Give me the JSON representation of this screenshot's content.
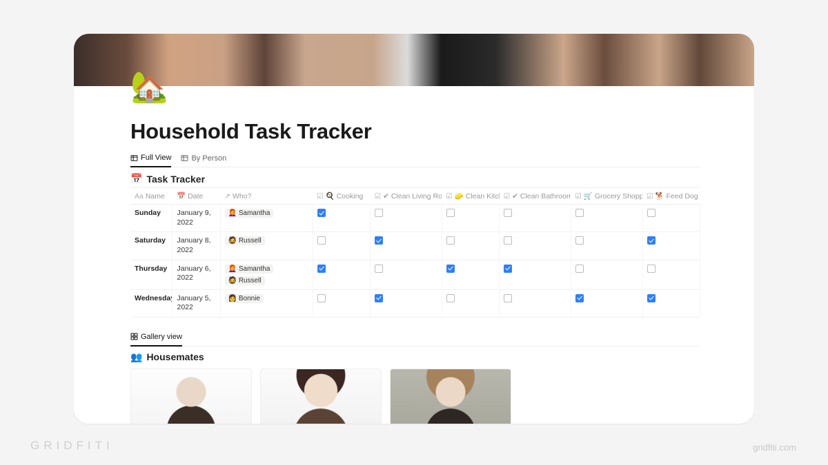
{
  "brand": {
    "left": "GRIDFITI",
    "right": "gridfiti.com"
  },
  "page": {
    "icon": "🏡",
    "title": "Household Task Tracker"
  },
  "tabs": [
    {
      "label": "Full View",
      "active": true
    },
    {
      "label": "By Person",
      "active": false
    }
  ],
  "db": {
    "icon": "📅",
    "title": "Task Tracker",
    "columns": {
      "name": "Name",
      "date": "Date",
      "who": "Who?",
      "cooking": "Cooking",
      "living": "Clean Living Room",
      "kitchen": "Clean Kitchen",
      "bath": "Clean Bathroom",
      "grocery": "Grocery Shopping",
      "dog": "Feed Dog"
    },
    "column_icons": {
      "cooking": "🍳",
      "living": "✔",
      "kitchen": "🧽",
      "bath": "✔",
      "grocery": "🛒",
      "dog": "🐕"
    },
    "rows": [
      {
        "name": "Sunday",
        "date": "January 9, 2022",
        "who": [
          {
            "emoji": "👩‍🦰",
            "name": "Samantha"
          }
        ],
        "cooking": true,
        "living": false,
        "kitchen": false,
        "bath": false,
        "grocery": false,
        "dog": false
      },
      {
        "name": "Saturday",
        "date": "January 8, 2022",
        "who": [
          {
            "emoji": "🧔",
            "name": "Russell"
          }
        ],
        "cooking": false,
        "living": true,
        "kitchen": false,
        "bath": false,
        "grocery": false,
        "dog": true
      },
      {
        "name": "Thursday",
        "date": "January 6, 2022",
        "who": [
          {
            "emoji": "👩‍🦰",
            "name": "Samantha"
          },
          {
            "emoji": "🧔",
            "name": "Russell"
          }
        ],
        "cooking": true,
        "living": false,
        "kitchen": true,
        "bath": true,
        "grocery": false,
        "dog": false
      },
      {
        "name": "Wednesday",
        "date": "January 5, 2022",
        "who": [
          {
            "emoji": "👩",
            "name": "Bonnie"
          }
        ],
        "cooking": false,
        "living": true,
        "kitchen": false,
        "bath": false,
        "grocery": true,
        "dog": true
      }
    ]
  },
  "gallery": {
    "tab_label": "Gallery view",
    "icon": "👥",
    "title": "Housemates",
    "cards": [
      {},
      {},
      {}
    ]
  }
}
